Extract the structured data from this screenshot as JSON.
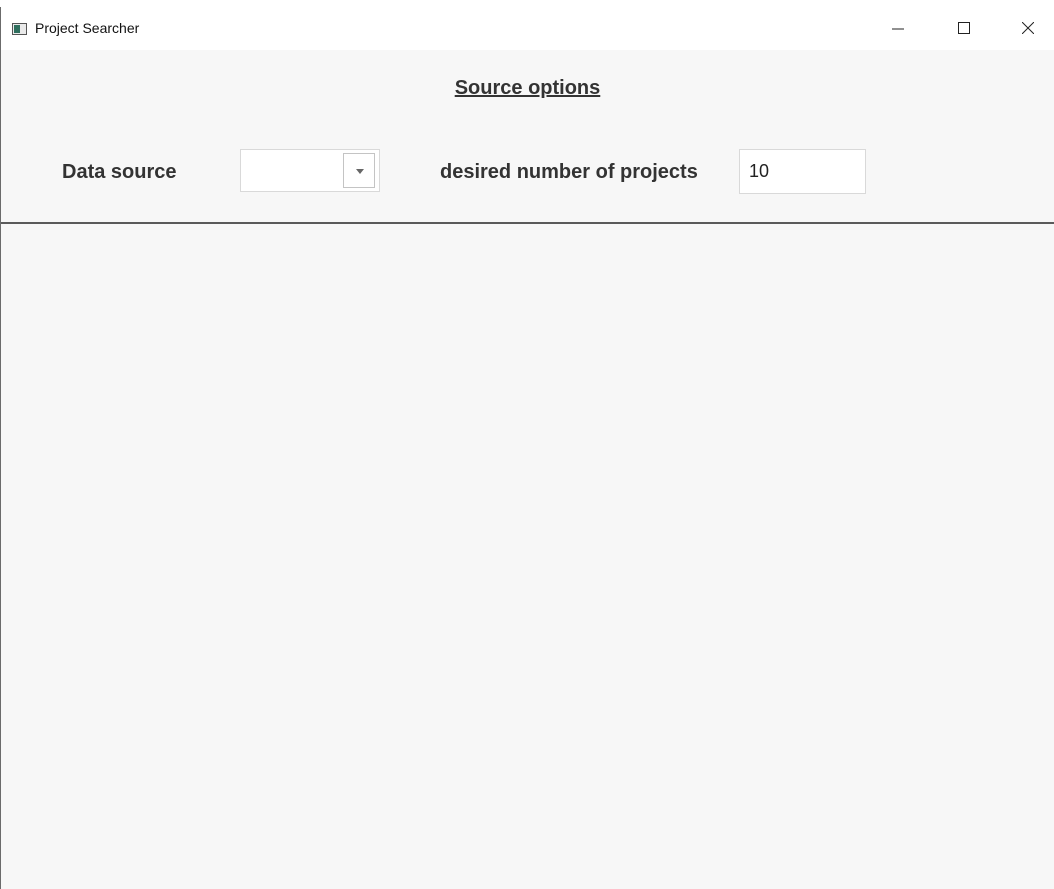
{
  "window": {
    "title": "Project Searcher",
    "icon": "app-window-icon",
    "controls": {
      "minimize": "minimize-icon",
      "maximize": "maximize-icon",
      "close": "close-icon"
    }
  },
  "source_options": {
    "heading": "Source options",
    "data_source": {
      "label": "Data source",
      "selected_value": "",
      "dropdown_icon": "chevron-down-icon"
    },
    "project_count": {
      "label": "desired number of projects",
      "value": "10"
    }
  }
}
